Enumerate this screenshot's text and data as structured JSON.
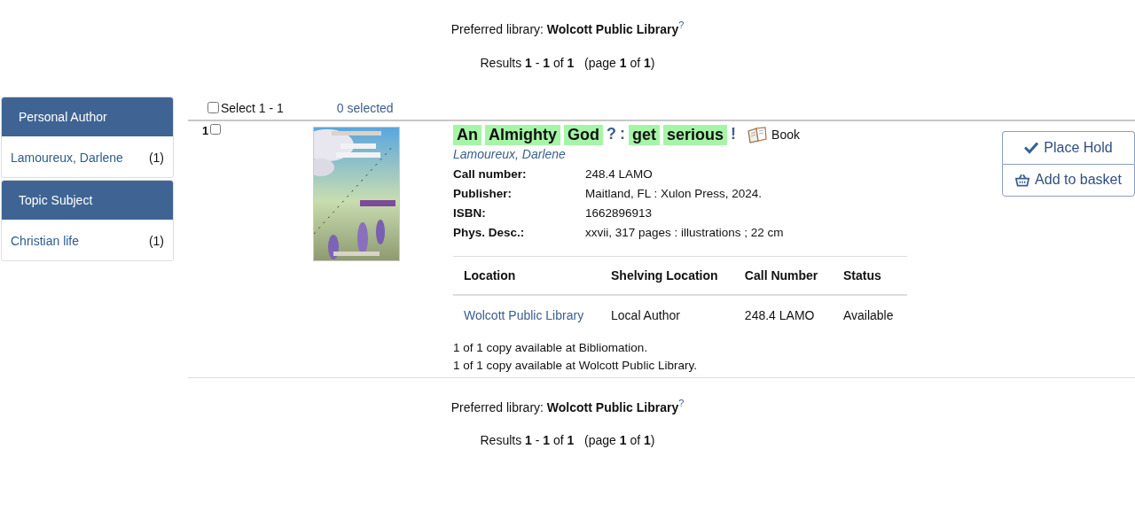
{
  "header": {
    "preferred": "Preferred library: **Wolcott Public Library**$^{?}$",
    "results": "Results **1** - **1** of **1**   (page **1** of **1**)"
  },
  "facets": [
    {
      "heading": "Personal Author",
      "items": [
        {
          "label": "Lamoureux, Darlene",
          "count": "(1)"
        }
      ]
    },
    {
      "heading": "Topic Subject",
      "items": [
        {
          "label": "Christian life",
          "count": "(1)"
        }
      ]
    }
  ],
  "selection": {
    "select_label": "Select 1 - 1",
    "checked": false,
    "selected_count": "0 selected"
  },
  "results": [
    {
      "number": "1",
      "checked": false,
      "title": [
        {
          "text": "An",
          "highlighted": true
        },
        {
          "text": "Almighty",
          "highlighted": true
        },
        {
          "text": "God",
          "highlighted": true
        },
        {
          "text": "?",
          "highlighted": false
        },
        {
          "text": ":",
          "highlighted": false
        },
        {
          "text": "get",
          "highlighted": true
        },
        {
          "text": "serious",
          "highlighted": true
        },
        {
          "text": "!",
          "highlighted": false
        }
      ],
      "format": "Book",
      "author": "Lamoureux, Darlene",
      "details": [
        {
          "label": "Call number:",
          "value": "248.4 LAMO"
        },
        {
          "label": "Publisher:",
          "value": "Maitland, FL : Xulon Press, 2024."
        },
        {
          "label": "ISBN:",
          "value": "1662896913"
        },
        {
          "label": "Phys. Desc.:",
          "value": "xxvii, 317 pages : illustrations ; 22 cm"
        }
      ],
      "holdings": {
        "columns": [
          "Location",
          "Shelving Location",
          "Call Number",
          "Status"
        ],
        "rows": [
          [
            "Wolcott Public Library",
            "Local Author",
            "248.4 LAMO",
            "Available"
          ]
        ]
      },
      "availability": [
        "1 of 1 copy available at Bibliomation.",
        "1 of 1 copy available at Wolcott Public Library."
      ],
      "actions": [
        {
          "kind": "hold",
          "label": "Place Hold"
        },
        {
          "kind": "basket",
          "label": "Add to basket"
        }
      ]
    }
  ],
  "footer": {
    "preferred": "Preferred library: **Wolcott Public Library**$^{?}$",
    "results": "Results **1** - **1** of **1**   (page **1** of **1**)"
  }
}
